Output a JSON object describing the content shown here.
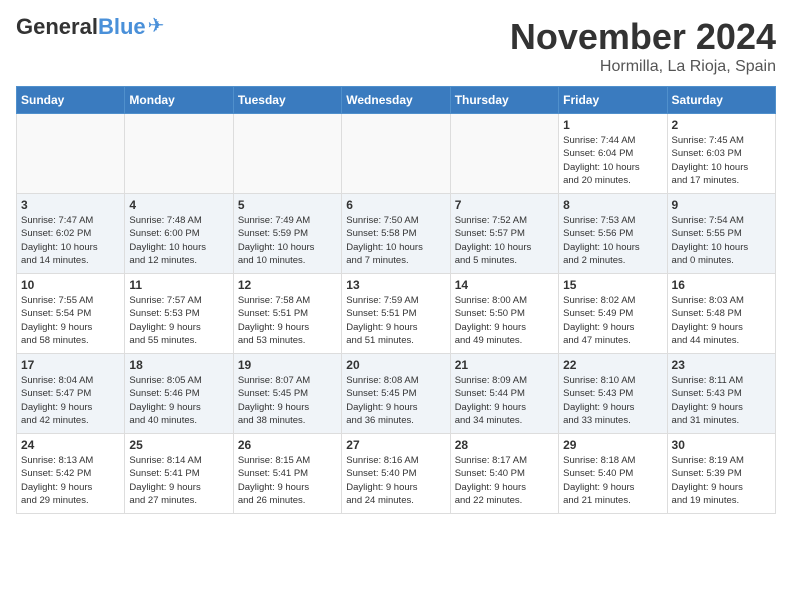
{
  "header": {
    "logo_general": "General",
    "logo_blue": "Blue",
    "month": "November 2024",
    "location": "Hormilla, La Rioja, Spain"
  },
  "weekdays": [
    "Sunday",
    "Monday",
    "Tuesday",
    "Wednesday",
    "Thursday",
    "Friday",
    "Saturday"
  ],
  "weeks": [
    [
      {
        "day": "",
        "info": ""
      },
      {
        "day": "",
        "info": ""
      },
      {
        "day": "",
        "info": ""
      },
      {
        "day": "",
        "info": ""
      },
      {
        "day": "",
        "info": ""
      },
      {
        "day": "1",
        "info": "Sunrise: 7:44 AM\nSunset: 6:04 PM\nDaylight: 10 hours\nand 20 minutes."
      },
      {
        "day": "2",
        "info": "Sunrise: 7:45 AM\nSunset: 6:03 PM\nDaylight: 10 hours\nand 17 minutes."
      }
    ],
    [
      {
        "day": "3",
        "info": "Sunrise: 7:47 AM\nSunset: 6:02 PM\nDaylight: 10 hours\nand 14 minutes."
      },
      {
        "day": "4",
        "info": "Sunrise: 7:48 AM\nSunset: 6:00 PM\nDaylight: 10 hours\nand 12 minutes."
      },
      {
        "day": "5",
        "info": "Sunrise: 7:49 AM\nSunset: 5:59 PM\nDaylight: 10 hours\nand 10 minutes."
      },
      {
        "day": "6",
        "info": "Sunrise: 7:50 AM\nSunset: 5:58 PM\nDaylight: 10 hours\nand 7 minutes."
      },
      {
        "day": "7",
        "info": "Sunrise: 7:52 AM\nSunset: 5:57 PM\nDaylight: 10 hours\nand 5 minutes."
      },
      {
        "day": "8",
        "info": "Sunrise: 7:53 AM\nSunset: 5:56 PM\nDaylight: 10 hours\nand 2 minutes."
      },
      {
        "day": "9",
        "info": "Sunrise: 7:54 AM\nSunset: 5:55 PM\nDaylight: 10 hours\nand 0 minutes."
      }
    ],
    [
      {
        "day": "10",
        "info": "Sunrise: 7:55 AM\nSunset: 5:54 PM\nDaylight: 9 hours\nand 58 minutes."
      },
      {
        "day": "11",
        "info": "Sunrise: 7:57 AM\nSunset: 5:53 PM\nDaylight: 9 hours\nand 55 minutes."
      },
      {
        "day": "12",
        "info": "Sunrise: 7:58 AM\nSunset: 5:51 PM\nDaylight: 9 hours\nand 53 minutes."
      },
      {
        "day": "13",
        "info": "Sunrise: 7:59 AM\nSunset: 5:51 PM\nDaylight: 9 hours\nand 51 minutes."
      },
      {
        "day": "14",
        "info": "Sunrise: 8:00 AM\nSunset: 5:50 PM\nDaylight: 9 hours\nand 49 minutes."
      },
      {
        "day": "15",
        "info": "Sunrise: 8:02 AM\nSunset: 5:49 PM\nDaylight: 9 hours\nand 47 minutes."
      },
      {
        "day": "16",
        "info": "Sunrise: 8:03 AM\nSunset: 5:48 PM\nDaylight: 9 hours\nand 44 minutes."
      }
    ],
    [
      {
        "day": "17",
        "info": "Sunrise: 8:04 AM\nSunset: 5:47 PM\nDaylight: 9 hours\nand 42 minutes."
      },
      {
        "day": "18",
        "info": "Sunrise: 8:05 AM\nSunset: 5:46 PM\nDaylight: 9 hours\nand 40 minutes."
      },
      {
        "day": "19",
        "info": "Sunrise: 8:07 AM\nSunset: 5:45 PM\nDaylight: 9 hours\nand 38 minutes."
      },
      {
        "day": "20",
        "info": "Sunrise: 8:08 AM\nSunset: 5:45 PM\nDaylight: 9 hours\nand 36 minutes."
      },
      {
        "day": "21",
        "info": "Sunrise: 8:09 AM\nSunset: 5:44 PM\nDaylight: 9 hours\nand 34 minutes."
      },
      {
        "day": "22",
        "info": "Sunrise: 8:10 AM\nSunset: 5:43 PM\nDaylight: 9 hours\nand 33 minutes."
      },
      {
        "day": "23",
        "info": "Sunrise: 8:11 AM\nSunset: 5:43 PM\nDaylight: 9 hours\nand 31 minutes."
      }
    ],
    [
      {
        "day": "24",
        "info": "Sunrise: 8:13 AM\nSunset: 5:42 PM\nDaylight: 9 hours\nand 29 minutes."
      },
      {
        "day": "25",
        "info": "Sunrise: 8:14 AM\nSunset: 5:41 PM\nDaylight: 9 hours\nand 27 minutes."
      },
      {
        "day": "26",
        "info": "Sunrise: 8:15 AM\nSunset: 5:41 PM\nDaylight: 9 hours\nand 26 minutes."
      },
      {
        "day": "27",
        "info": "Sunrise: 8:16 AM\nSunset: 5:40 PM\nDaylight: 9 hours\nand 24 minutes."
      },
      {
        "day": "28",
        "info": "Sunrise: 8:17 AM\nSunset: 5:40 PM\nDaylight: 9 hours\nand 22 minutes."
      },
      {
        "day": "29",
        "info": "Sunrise: 8:18 AM\nSunset: 5:40 PM\nDaylight: 9 hours\nand 21 minutes."
      },
      {
        "day": "30",
        "info": "Sunrise: 8:19 AM\nSunset: 5:39 PM\nDaylight: 9 hours\nand 19 minutes."
      }
    ]
  ]
}
